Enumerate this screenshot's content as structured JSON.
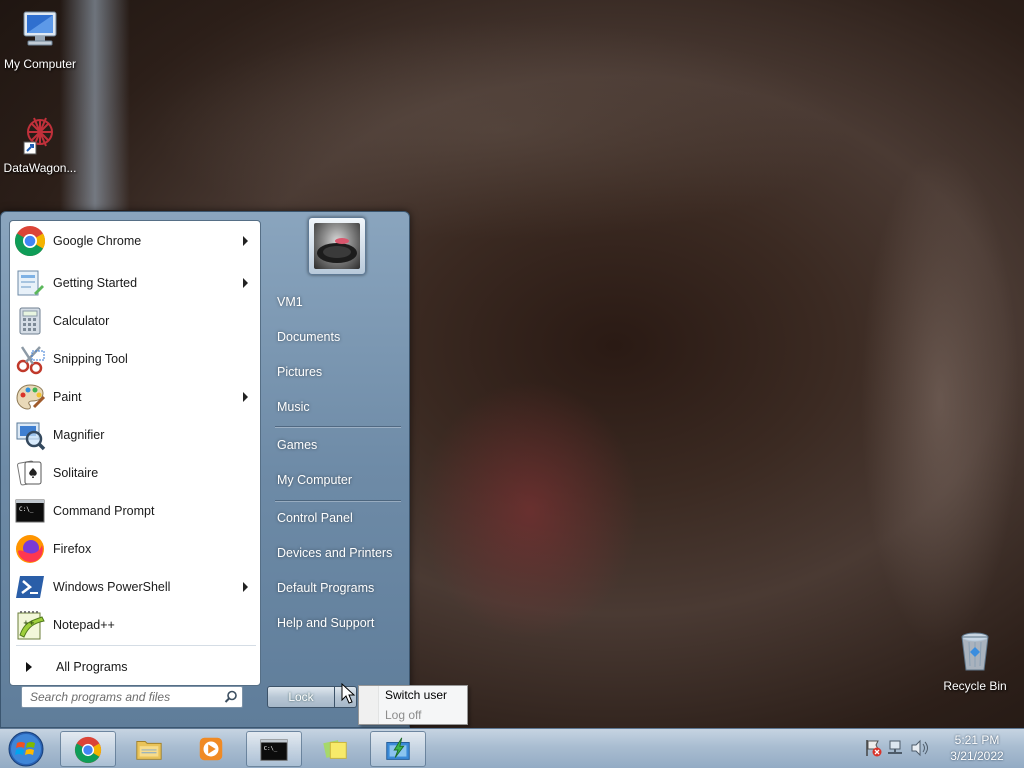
{
  "desktop": {
    "icons": [
      {
        "label": "My Computer"
      },
      {
        "label": "DataWagon..."
      },
      {
        "label": "Recycle Bin"
      }
    ]
  },
  "start_menu": {
    "programs": [
      {
        "label": "Google Chrome",
        "has_submenu": true,
        "icon": "chrome-icon"
      },
      {
        "label": "Getting Started",
        "has_submenu": true,
        "icon": "getting-started-icon"
      },
      {
        "label": "Calculator",
        "has_submenu": false,
        "icon": "calculator-icon"
      },
      {
        "label": "Snipping Tool",
        "has_submenu": false,
        "icon": "scissors-icon"
      },
      {
        "label": "Paint",
        "has_submenu": true,
        "icon": "paint-palette-icon"
      },
      {
        "label": "Magnifier",
        "has_submenu": false,
        "icon": "magnifier-icon"
      },
      {
        "label": "Solitaire",
        "has_submenu": false,
        "icon": "cards-icon"
      },
      {
        "label": "Command Prompt",
        "has_submenu": false,
        "icon": "cmd-icon"
      },
      {
        "label": "Firefox",
        "has_submenu": false,
        "icon": "firefox-icon"
      },
      {
        "label": "Windows PowerShell",
        "has_submenu": true,
        "icon": "powershell-icon"
      },
      {
        "label": "Notepad++",
        "has_submenu": false,
        "icon": "notepadpp-icon"
      }
    ],
    "all_programs": "All Programs",
    "search_placeholder": "Search programs and files",
    "right_items": [
      {
        "label": "VM1"
      },
      {
        "label": "Documents"
      },
      {
        "label": "Pictures"
      },
      {
        "label": "Music"
      },
      {
        "label": "Games"
      },
      {
        "label": "My Computer"
      },
      {
        "label": "Control Panel"
      },
      {
        "label": "Devices and Printers"
      },
      {
        "label": "Default Programs"
      },
      {
        "label": "Help and Support"
      }
    ],
    "lock_label": "Lock",
    "shutdown_submenu": {
      "switch_user": "Switch user",
      "log_off": "Log off"
    }
  },
  "taskbar": {
    "clock_time": "5:21 PM",
    "clock_date": "3/21/2022"
  },
  "colors": {
    "start_menu_blue": "#6e8ba7",
    "taskbar_blue": "#a9bdd1"
  }
}
